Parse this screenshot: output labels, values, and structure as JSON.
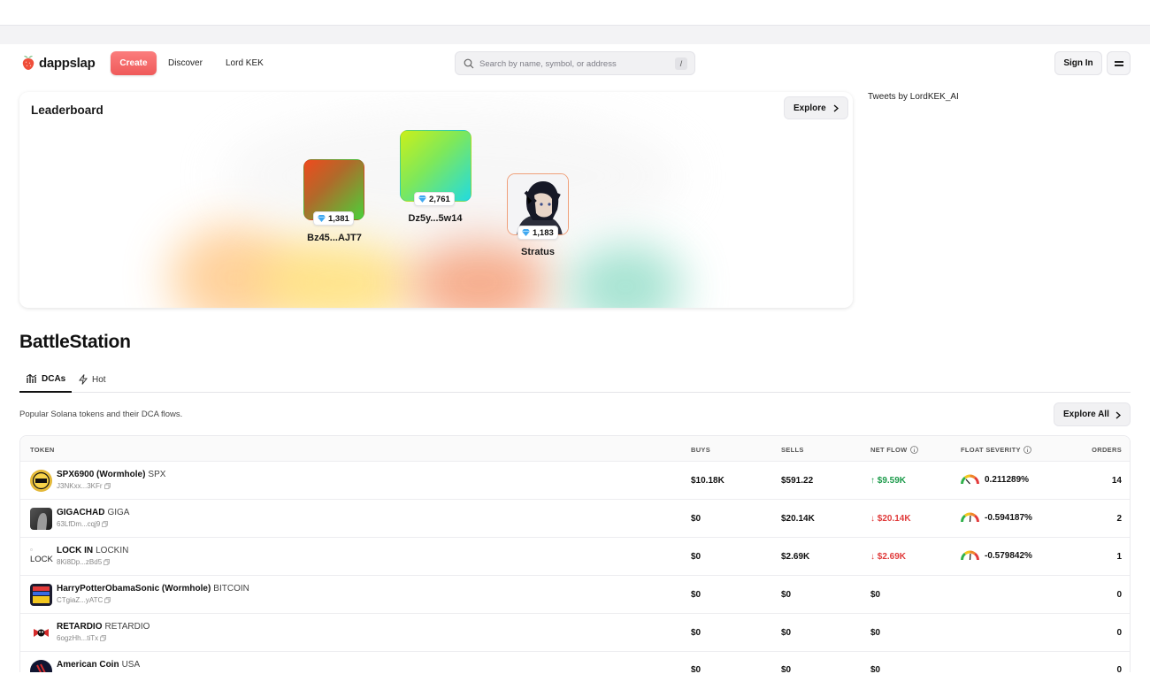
{
  "header": {
    "brand": "dappslap",
    "create_label": "Create",
    "nav": [
      "Discover",
      "Lord KEK"
    ],
    "search_placeholder": "Search by name, symbol, or address",
    "search_shortcut": "/",
    "signin_label": "Sign In"
  },
  "leaderboard": {
    "title": "Leaderboard",
    "explore_label": "Explore",
    "entries": [
      {
        "name": "Bz45...AJT7",
        "score": "1,381"
      },
      {
        "name": "Dz5y...5w14",
        "score": "2,761"
      },
      {
        "name": "Stratus",
        "score": "1,183"
      }
    ]
  },
  "tweets_label": "Tweets by LordKEK_AI",
  "battlestation": {
    "title": "BattleStation",
    "tabs": [
      "DCAs",
      "Hot"
    ],
    "description": "Popular Solana tokens and their DCA flows.",
    "explore_all_label": "Explore All"
  },
  "table": {
    "headers": {
      "token": "TOKEN",
      "buys": "BUYS",
      "sells": "SELLS",
      "net_flow": "NET FLOW",
      "float_severity": "FLOAT SEVERITY",
      "orders": "ORDERS"
    },
    "rows": [
      {
        "name": "SPX6900 (Wormhole)",
        "symbol": "SPX",
        "address": "J3NKxx...3KFr",
        "buys": "$10.18K",
        "sells": "$591.22",
        "net": "↑ $9.59K",
        "net_dir": "pos",
        "severity": "0.211289%",
        "orders": "14",
        "icon": "spx-icon"
      },
      {
        "name": "GIGACHAD",
        "symbol": "GIGA",
        "address": "63LfDm...cqj9",
        "buys": "$0",
        "sells": "$20.14K",
        "net": "↓ $20.14K",
        "net_dir": "neg",
        "severity": "-0.594187%",
        "orders": "2",
        "icon": "giga-icon"
      },
      {
        "name": "LOCK IN",
        "symbol": "LOCKIN",
        "address": "8Ki8Dp...zBd5",
        "buys": "$0",
        "sells": "$2.69K",
        "net": "↓ $2.69K",
        "net_dir": "neg",
        "severity": "-0.579842%",
        "orders": "1",
        "icon": "lock-icon",
        "icon_alt": "LOCK"
      },
      {
        "name": "HarryPotterObamaSonic (Wormhole)",
        "symbol": "BITCOIN",
        "address": "CTgiaZ...yATC",
        "buys": "$0",
        "sells": "$0",
        "net": "$0",
        "net_dir": "zero",
        "severity": "",
        "orders": "0",
        "icon": "bitcoin-icon"
      },
      {
        "name": "RETARDIO",
        "symbol": "RETARDIO",
        "address": "6ogzHh...tiTx",
        "buys": "$0",
        "sells": "$0",
        "net": "$0",
        "net_dir": "zero",
        "severity": "",
        "orders": "0",
        "icon": "retardio-icon"
      },
      {
        "name": "American Coin",
        "symbol": "USA",
        "address": "",
        "buys": "$0",
        "sells": "$0",
        "net": "$0",
        "net_dir": "zero",
        "severity": "",
        "orders": "0",
        "icon": "usa-icon"
      }
    ]
  },
  "colors": {
    "create_button": "#ef5a5a",
    "positive": "#1d9b4b",
    "negative": "#e03b3b"
  }
}
